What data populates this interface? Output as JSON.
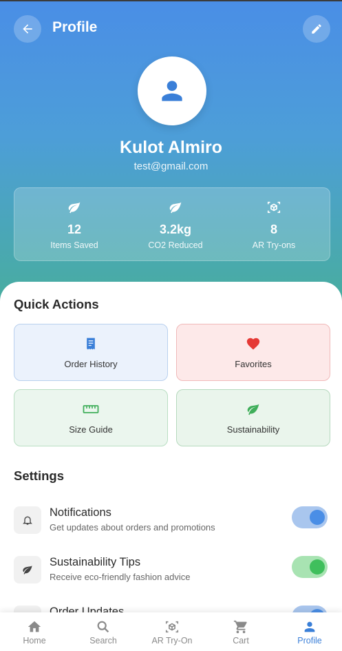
{
  "header": {
    "title": "Profile",
    "back_icon": "arrow-left-icon",
    "edit_icon": "pencil-icon",
    "gradient_colors": [
      "#4a8ee6",
      "#48ad9f"
    ]
  },
  "profile": {
    "avatar_icon": "person-icon",
    "name": "Kulot Almiro",
    "email": "test@gmail.com"
  },
  "stats": [
    {
      "icon": "leaf-icon",
      "value": "12",
      "label": "Items Saved"
    },
    {
      "icon": "leaf-icon",
      "value": "3.2kg",
      "label": "CO2 Reduced"
    },
    {
      "icon": "ar-cube-icon",
      "value": "8",
      "label": "AR Try-ons"
    }
  ],
  "quick_actions": {
    "title": "Quick Actions",
    "items": [
      {
        "icon": "receipt-icon",
        "label": "Order History",
        "color": "#3a7fd8"
      },
      {
        "icon": "heart-icon",
        "label": "Favorites",
        "color": "#e53935"
      },
      {
        "icon": "ruler-icon",
        "label": "Size Guide",
        "color": "#3fae5a"
      },
      {
        "icon": "leaf-icon",
        "label": "Sustainability",
        "color": "#3fae5a"
      }
    ]
  },
  "settings": {
    "title": "Settings",
    "items": [
      {
        "icon": "bell-icon",
        "title": "Notifications",
        "subtitle": "Get updates about orders and promotions",
        "enabled": true,
        "color": "#4a8ee6"
      },
      {
        "icon": "leaf-icon",
        "title": "Sustainability Tips",
        "subtitle": "Receive eco-friendly fashion advice",
        "enabled": true,
        "color": "#3fbf5c"
      },
      {
        "icon": "box-icon",
        "title": "Order Updates",
        "subtitle": "",
        "enabled": true,
        "color": "#4a8ee6"
      }
    ]
  },
  "bottom_nav": {
    "items": [
      {
        "icon": "home-icon",
        "label": "Home",
        "active": false
      },
      {
        "icon": "search-icon",
        "label": "Search",
        "active": false
      },
      {
        "icon": "ar-cube-icon",
        "label": "AR Try-On",
        "active": false
      },
      {
        "icon": "cart-icon",
        "label": "Cart",
        "active": false
      },
      {
        "icon": "person-icon",
        "label": "Profile",
        "active": true
      }
    ],
    "active_color": "#3a7fd8",
    "inactive_color": "#8a8a8a"
  }
}
